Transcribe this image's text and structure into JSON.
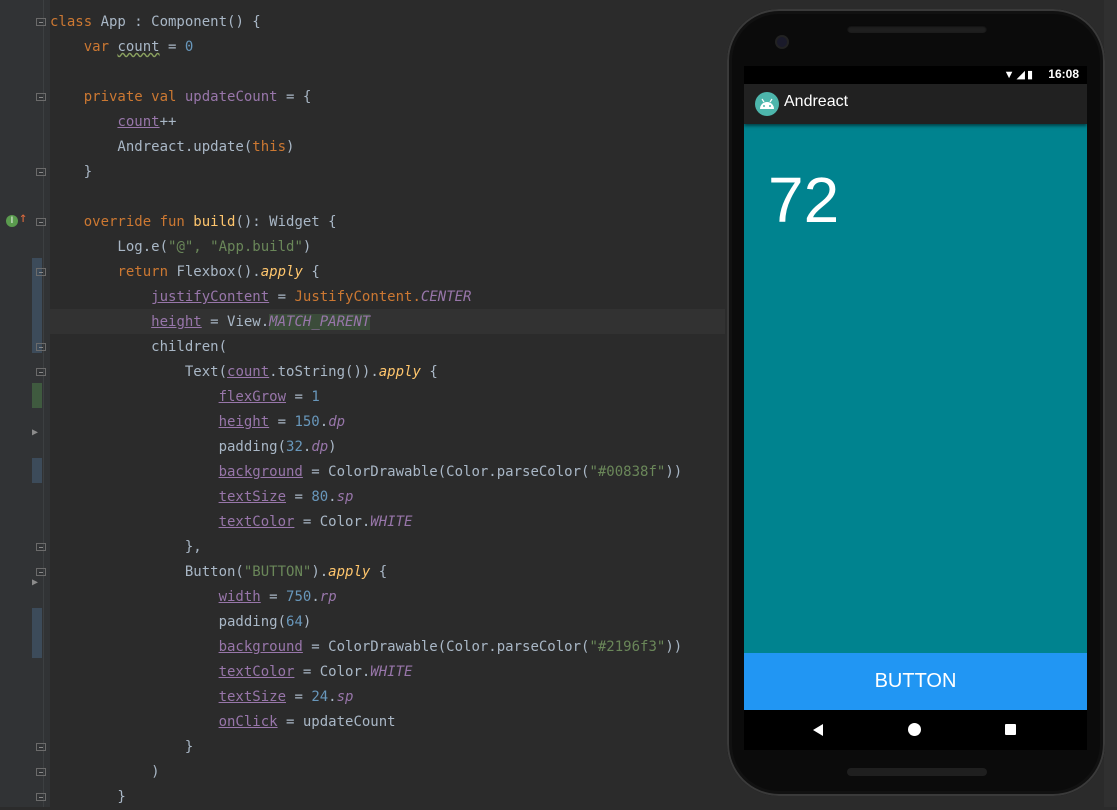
{
  "editor": {
    "language": "Kotlin",
    "lines": [
      [
        {
          "t": "class ",
          "c": "kw"
        },
        {
          "t": "App : Component() {"
        }
      ],
      [
        {
          "t": "    "
        },
        {
          "t": "var ",
          "c": "kw"
        },
        {
          "t": "count",
          "c": "uvar"
        },
        {
          "t": " = "
        },
        {
          "t": "0",
          "c": "num"
        }
      ],
      [
        {
          "t": ""
        }
      ],
      [
        {
          "t": "    "
        },
        {
          "t": "private val ",
          "c": "kw"
        },
        {
          "t": "updateCount",
          "c": "field"
        },
        {
          "t": " = {"
        }
      ],
      [
        {
          "t": "        "
        },
        {
          "t": "count",
          "c": "prop"
        },
        {
          "t": "++"
        }
      ],
      [
        {
          "t": "        Andreact.update("
        },
        {
          "t": "this",
          "c": "thiskw"
        },
        {
          "t": ")"
        }
      ],
      [
        {
          "t": "    }"
        }
      ],
      [
        {
          "t": ""
        }
      ],
      [
        {
          "t": "    "
        },
        {
          "t": "override fun ",
          "c": "kw"
        },
        {
          "t": "build",
          "c": "fn"
        },
        {
          "t": "(): Widget {"
        }
      ],
      [
        {
          "t": "        Log.e("
        },
        {
          "t": "\"@\", \"App.build\"",
          "c": "str"
        },
        {
          "t": ")"
        }
      ],
      [
        {
          "t": "        "
        },
        {
          "t": "return ",
          "c": "kw"
        },
        {
          "t": "Flexbox()."
        },
        {
          "t": "apply",
          "c": "ext"
        },
        {
          "t": " {"
        }
      ],
      [
        {
          "t": "            "
        },
        {
          "t": "justifyContent",
          "c": "prop"
        },
        {
          "t": " = "
        },
        {
          "t": "JustifyContent.",
          "c": "kw"
        },
        {
          "t": "CENTER",
          "c": "konst"
        }
      ],
      [
        {
          "t": "            "
        },
        {
          "t": "height",
          "c": "prop"
        },
        {
          "t": " = View."
        },
        {
          "t": "MATCH_PARENT",
          "c": "konst hl"
        }
      ],
      [
        {
          "t": "            children("
        }
      ],
      [
        {
          "t": "                Text("
        },
        {
          "t": "count",
          "c": "prop"
        },
        {
          "t": ".toString())."
        },
        {
          "t": "apply",
          "c": "ext"
        },
        {
          "t": " {"
        }
      ],
      [
        {
          "t": "                    "
        },
        {
          "t": "flexGrow",
          "c": "prop"
        },
        {
          "t": " = "
        },
        {
          "t": "1",
          "c": "num"
        }
      ],
      [
        {
          "t": "                    "
        },
        {
          "t": "height",
          "c": "prop"
        },
        {
          "t": " = "
        },
        {
          "t": "150",
          "c": "num"
        },
        {
          "t": "."
        },
        {
          "t": "dp",
          "c": "unit"
        }
      ],
      [
        {
          "t": "                    padding("
        },
        {
          "t": "32",
          "c": "num"
        },
        {
          "t": "."
        },
        {
          "t": "dp",
          "c": "unit"
        },
        {
          "t": ")"
        }
      ],
      [
        {
          "t": "                    "
        },
        {
          "t": "background",
          "c": "prop"
        },
        {
          "t": " = ColorDrawable(Color.parseColor("
        },
        {
          "t": "\"#00838f\"",
          "c": "str"
        },
        {
          "t": "))"
        }
      ],
      [
        {
          "t": "                    "
        },
        {
          "t": "textSize",
          "c": "prop"
        },
        {
          "t": " = "
        },
        {
          "t": "80",
          "c": "num"
        },
        {
          "t": "."
        },
        {
          "t": "sp",
          "c": "unit"
        }
      ],
      [
        {
          "t": "                    "
        },
        {
          "t": "textColor",
          "c": "prop"
        },
        {
          "t": " = Color."
        },
        {
          "t": "WHITE",
          "c": "konst"
        }
      ],
      [
        {
          "t": "                },"
        }
      ],
      [
        {
          "t": "                Button("
        },
        {
          "t": "\"BUTTON\"",
          "c": "str"
        },
        {
          "t": ")."
        },
        {
          "t": "apply",
          "c": "ext"
        },
        {
          "t": " {"
        }
      ],
      [
        {
          "t": "                    "
        },
        {
          "t": "width",
          "c": "prop"
        },
        {
          "t": " = "
        },
        {
          "t": "750",
          "c": "num"
        },
        {
          "t": "."
        },
        {
          "t": "rp",
          "c": "unit"
        }
      ],
      [
        {
          "t": "                    padding("
        },
        {
          "t": "64",
          "c": "num"
        },
        {
          "t": ")"
        }
      ],
      [
        {
          "t": "                    "
        },
        {
          "t": "background",
          "c": "prop"
        },
        {
          "t": " = ColorDrawable(Color.parseColor("
        },
        {
          "t": "\"#2196f3\"",
          "c": "str"
        },
        {
          "t": "))"
        }
      ],
      [
        {
          "t": "                    "
        },
        {
          "t": "textColor",
          "c": "prop"
        },
        {
          "t": " = Color."
        },
        {
          "t": "WHITE",
          "c": "konst"
        }
      ],
      [
        {
          "t": "                    "
        },
        {
          "t": "textSize",
          "c": "prop"
        },
        {
          "t": " = "
        },
        {
          "t": "24",
          "c": "num"
        },
        {
          "t": "."
        },
        {
          "t": "sp",
          "c": "unit"
        }
      ],
      [
        {
          "t": "                    "
        },
        {
          "t": "onClick",
          "c": "prop"
        },
        {
          "t": " = updateCount"
        }
      ],
      [
        {
          "t": "                }"
        }
      ],
      [
        {
          "t": "            )"
        }
      ],
      [
        {
          "t": "        }"
        }
      ]
    ]
  },
  "emulator": {
    "status_time": "16:08",
    "status_icons": "▼◢▮",
    "app_title": "Andreact",
    "count_value": "72",
    "button_label": "BUTTON",
    "colors": {
      "text_background": "#00838f",
      "button_background": "#2196f3"
    }
  },
  "icons": [
    "bulb-icon",
    "implements-icon",
    "fold-icon",
    "back-icon",
    "home-icon",
    "recents-icon",
    "android-app-icon",
    "wifi-icon",
    "signal-icon",
    "battery-icon"
  ]
}
